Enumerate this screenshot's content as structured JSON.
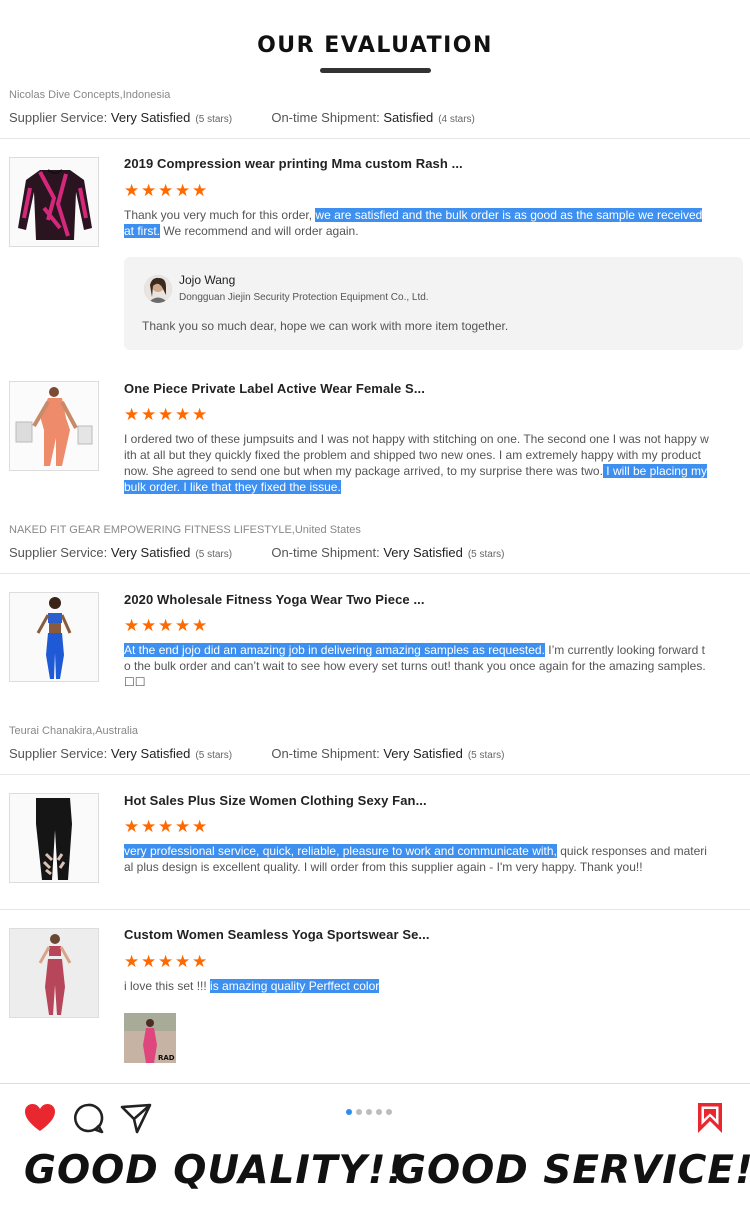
{
  "header": {
    "title": "OUR EVALUATION"
  },
  "groups": [
    {
      "buyer": "Nicolas Dive Concepts,Indonesia",
      "supplier_label": "Supplier Service:",
      "supplier_value": "Very Satisfied",
      "supplier_stars": "(5 stars)",
      "shipment_label": "On-time Shipment:",
      "shipment_value": "Satisfied",
      "shipment_stars": "(4 stars)"
    },
    {
      "buyer": "NAKED FIT GEAR EMPOWERING FITNESS LIFESTYLE,United States",
      "supplier_label": "Supplier Service:",
      "supplier_value": "Very Satisfied",
      "supplier_stars": "(5 stars)",
      "shipment_label": "On-time Shipment:",
      "shipment_value": "Very Satisfied",
      "shipment_stars": "(5 stars)"
    },
    {
      "buyer": "Teurai Chanakira,Australia",
      "supplier_label": "Supplier Service:",
      "supplier_value": "Very Satisfied",
      "supplier_stars": "(5 stars)",
      "shipment_label": "On-time Shipment:",
      "shipment_value": "Very Satisfied",
      "shipment_stars": "(5 stars)"
    }
  ],
  "reviews": [
    {
      "product": "2019 Compression wear printing Mma custom Rash ...",
      "rating": 5,
      "text_a": "Thank you very much for this order, ",
      "text_hl": "we are satisfied and the bulk order is as good as the sample we received at first.",
      "text_b": " We recommend and will order again."
    },
    {
      "product": "One Piece Private Label Active Wear Female S...",
      "rating": 5,
      "text_a": "I ordered two of these jumpsuits and I was not happy with stitching on one. The second one I was not happy with at all but they quickly fixed the problem and shipped two new ones. I am extremely happy with my product now. She agreed to send one but when my package arrived, to my surprise there was two.",
      "text_hl": " I will be placing my bulk order. I like that they fixed the issue.",
      "text_b": ""
    },
    {
      "product": "2020 Wholesale Fitness Yoga Wear Two Piece ...",
      "rating": 5,
      "text_a": "",
      "text_hl": "At the end jojo did an amazing job in delivering amazing samples as requested.",
      "text_b": " I’m currently looking forward to the bulk order and can’t wait to see how every set turns out! thank you once again for the amazing samples. ☐☐"
    },
    {
      "product": "Hot Sales Plus Size Women Clothing Sexy Fan...",
      "rating": 5,
      "text_a": "",
      "text_hl": "very professional service, quick, reliable, pleasure to work and communicate with,",
      "text_b": " quick responses and material plus design is excellent quality. I will order from this supplier again - I'm very happy. Thank you!!"
    },
    {
      "product": "Custom Women Seamless Yoga Sportswear Se...",
      "rating": 5,
      "text_a": "i love this set !!! ",
      "text_hl": "is amazing quality Perffect color",
      "text_b": ""
    }
  ],
  "reply": {
    "name": "Jojo Wang",
    "company": "Dongguan Jiejin Security Protection Equipment Co., Ltd.",
    "text": "Thank you so much dear, hope we can work with more item together."
  },
  "photo_label": "RAD",
  "social": {
    "icons": [
      "heart-icon",
      "comment-icon",
      "send-icon",
      "bookmark-icon"
    ],
    "carousel_active_index": 0,
    "carousel_count": 5,
    "accent_red": "#e8272f",
    "accent_blue": "#2d8cf0"
  },
  "slogans": [
    "GOOD QUALITY!!",
    "GOOD SERVICE!!"
  ],
  "colors": {
    "star": "#ff6a00",
    "highlight": "#3d8ff0"
  }
}
